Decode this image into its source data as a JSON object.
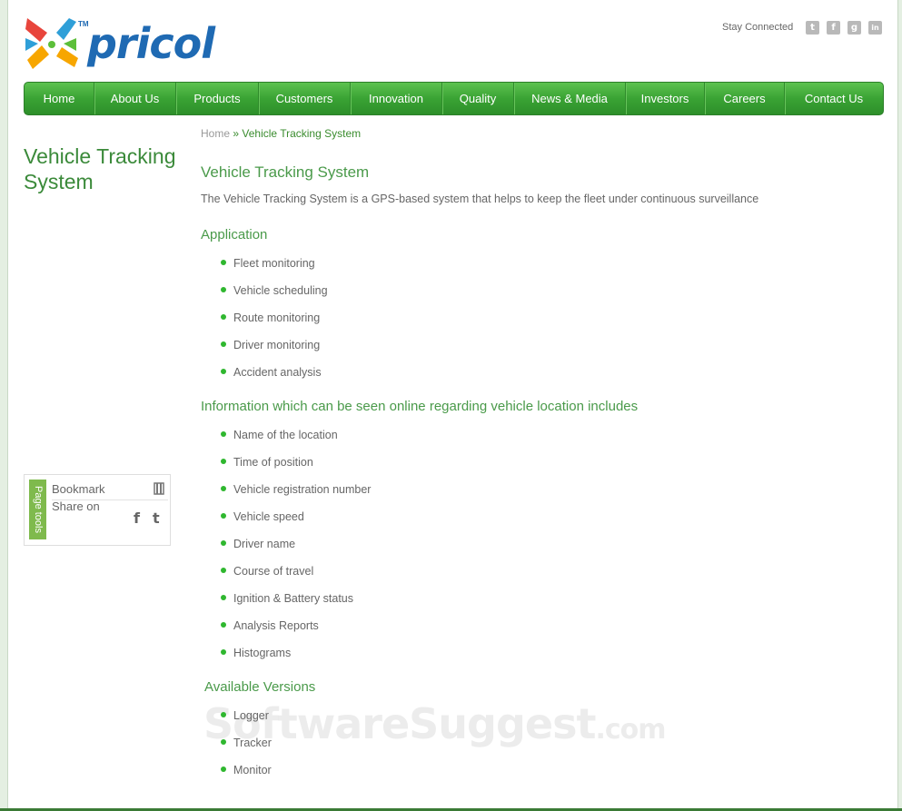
{
  "brand": {
    "name": "pricol",
    "tm": "TM"
  },
  "header": {
    "stay_connected": "Stay Connected",
    "social": [
      {
        "icon": "twitter-icon",
        "glyph": "t"
      },
      {
        "icon": "facebook-icon",
        "glyph": "f"
      },
      {
        "icon": "google-plus-icon",
        "glyph": "g"
      },
      {
        "icon": "linkedin-icon",
        "glyph": "in"
      }
    ]
  },
  "nav": [
    "Home",
    "About Us",
    "Products",
    "Customers",
    "Innovation",
    "Quality",
    "News & Media",
    "Investors",
    "Careers",
    "Contact Us"
  ],
  "sidebar": {
    "title": "Vehicle Tracking System",
    "page_tools": {
      "tab": "Page tools",
      "bookmark": "Bookmark",
      "share_on": "Share on"
    }
  },
  "breadcrumb": {
    "home": "Home",
    "sep": "»",
    "current": "Vehicle Tracking System"
  },
  "main": {
    "heading": "Vehicle Tracking System",
    "intro": "The Vehicle Tracking System is a GPS-based system that helps to keep the fleet under continuous surveillance",
    "sections": [
      {
        "heading": "Application",
        "items": [
          "Fleet monitoring",
          "Vehicle scheduling",
          "Route monitoring",
          "Driver monitoring",
          "Accident analysis"
        ]
      },
      {
        "heading": "Information which can be seen online regarding vehicle location includes",
        "items": [
          "Name of the location",
          "Time of position",
          "Vehicle registration number",
          "Vehicle speed",
          "Driver name",
          "Course of travel",
          "Ignition & Battery status",
          "Analysis Reports",
          "Histograms"
        ]
      },
      {
        "heading": "Available Versions",
        "items": [
          "Logger",
          "Tracker",
          "Monitor"
        ]
      }
    ]
  },
  "watermark": {
    "main": "SoftwareSuggest",
    "domain": ".com"
  },
  "colors": {
    "nav_green": "#3aa334",
    "heading_green": "#4a9a4a",
    "brand_blue": "#1f6ab3"
  }
}
